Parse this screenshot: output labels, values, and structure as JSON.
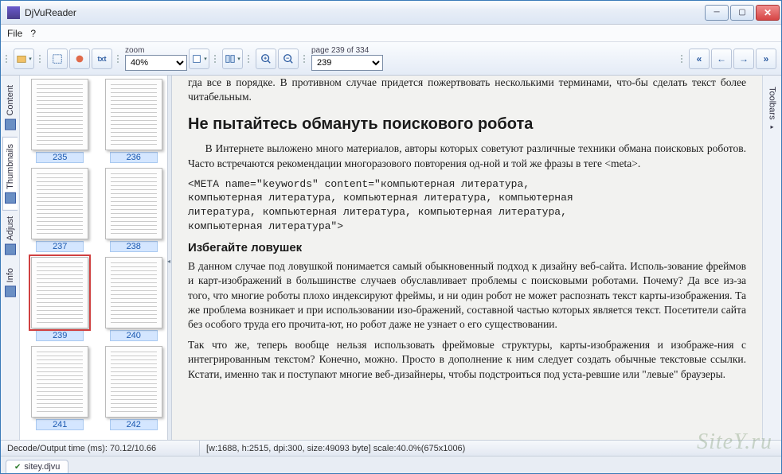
{
  "app": {
    "title": "DjVuReader"
  },
  "menu": {
    "file": "File",
    "help": "?"
  },
  "toolbar": {
    "zoom_label": "zoom",
    "zoom_value": "40%",
    "page_label": "page 239 of 334",
    "page_value": "239",
    "txt": "txt"
  },
  "side_tabs": {
    "content": "Content",
    "thumbnails": "Thumbnails",
    "adjust": "Adjust",
    "info": "Info"
  },
  "right_tabs": {
    "toolbars": "Toolbars"
  },
  "thumbnails": {
    "pages": [
      "235",
      "236",
      "237",
      "238",
      "239",
      "240",
      "241",
      "242"
    ],
    "selected": "239"
  },
  "page": {
    "p0": "гда все в порядке. В противном случае придется пожертвовать несколькими терминами, что-бы сделать текст более читабельным.",
    "h2": "Не пытайтесь обмануть поискового робота",
    "p1": "В Интернете выложено много материалов, авторы которых советуют различные техники обмана поисковых роботов. Часто встречаются рекомендации многоразового повторения од-ной и той же фразы в теге <meta>.",
    "code": "<META name=\"keywords\" content=\"компьютерная литература,\nкомпьютерная литература, компьютерная литература, компьютерная\nлитература, компьютерная литература, компьютерная литература,\nкомпьютерная литература\">",
    "h3": "Избегайте ловушек",
    "p2": "В данном случае под ловушкой понимается самый обыкновенный подход к дизайну веб-сайта. Исполь-зование фреймов и карт-изображений в большинстве случаев обуславливает проблемы с поисковыми роботами. Почему? Да все из-за того, что многие роботы плохо индексируют фреймы, и ни один робот не может распознать текст карты-изображения. Та же проблема возникает и при использовании изо-бражений, составной частью которых является текст. Посетители сайта без особого труда его прочита-ют, но робот даже не узнает о его существовании.",
    "p3": "Так что же, теперь вообще нельзя использовать фреймовые структуры, карты-изображения и изображе-ния с интегрированным текстом? Конечно, можно. Просто в дополнение к ним следует создать обычные текстовые ссылки. Кстати, именно так и поступают многие веб-дизайнеры, чтобы подстроиться под уста-ревшие или \"левые\" браузеры."
  },
  "status": {
    "decode": "Decode/Output time (ms): 70.12/10.66",
    "info": "[w:1688, h:2515, dpi:300, size:49093 byte] scale:40.0%(675x1006)"
  },
  "doc_tab": {
    "name": "sitey.djvu"
  },
  "watermark": "SiteY.ru"
}
